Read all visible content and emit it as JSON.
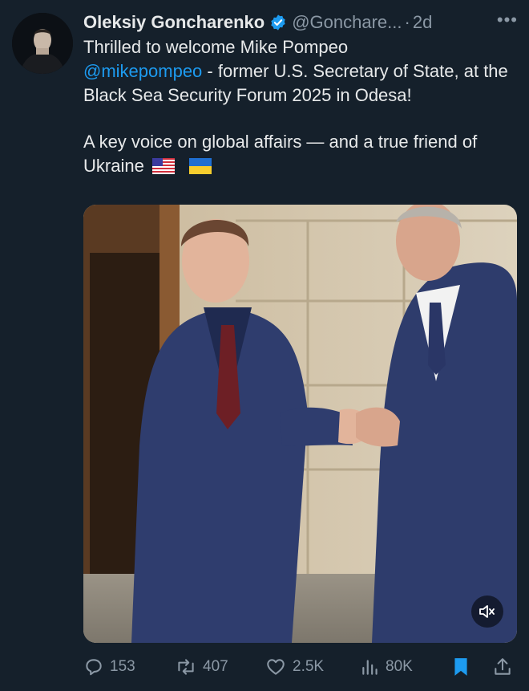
{
  "tweet": {
    "author_name": "Oleksiy Goncharenko",
    "handle": "@Gonchare...",
    "separator": "·",
    "time": "2d",
    "more_label": "•••",
    "text_line1": "Thrilled to welcome Mike Pompeo",
    "mention": "@mikepompeo",
    "text_after_mention": " - former U.S. Secretary of State, at the Black Sea Security Forum 2025 in Odesa!",
    "text_para2": "A key voice on global affairs — and a true friend of Ukraine"
  },
  "actions": {
    "replies": "153",
    "reposts": "407",
    "likes": "2.5K",
    "views": "80K"
  },
  "colors": {
    "background": "#15202b",
    "text": "#e7e9ea",
    "muted": "#8b98a5",
    "accent": "#1d9bf0"
  }
}
